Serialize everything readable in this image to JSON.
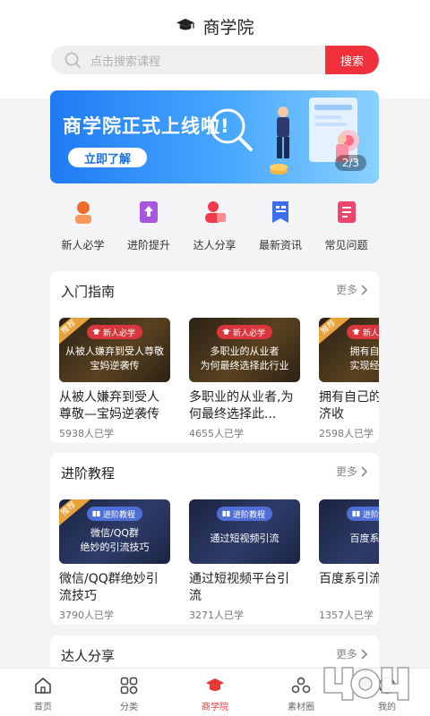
{
  "header": {
    "title": "商学院"
  },
  "search": {
    "placeholder": "点击搜索课程",
    "button": "搜索"
  },
  "banner": {
    "title": "商学院正式上线啦!",
    "cta": "立即了解",
    "page_current": 2,
    "page_total": 3,
    "page_label": "2/3"
  },
  "categories": [
    {
      "label": "新人必学",
      "icon": "badge-person-icon",
      "color": "#f06a2a"
    },
    {
      "label": "进阶提升",
      "icon": "book-up-icon",
      "color": "#a855e0"
    },
    {
      "label": "达人分享",
      "icon": "person-share-icon",
      "color": "#f03a4a"
    },
    {
      "label": "最新资讯",
      "icon": "news-flag-icon",
      "color": "#3b6ff0"
    },
    {
      "label": "常见问题",
      "icon": "notebook-icon",
      "color": "#f0456a"
    }
  ],
  "sections": [
    {
      "title": "入门指南",
      "more": "更多",
      "cards": [
        {
          "recommended": true,
          "badge_label": "推荐",
          "tag": "新人必学",
          "cover": [
            "从被人嫌弃到受人尊敬",
            "宝妈逆袭传"
          ],
          "title": "从被人嫌弃到受人尊敬—宝妈逆袭传",
          "learners": "5938人已学"
        },
        {
          "recommended": false,
          "tag": "新人必学",
          "cover": [
            "多职业的从业者",
            "为何最终选择此行业"
          ],
          "title": "多职业的从业者,为何最终选择此...",
          "learners": "4655人已学"
        },
        {
          "recommended": true,
          "badge_label": "推荐",
          "tag": "新人必学",
          "cover": [
            "拥有自己的",
            "实现经济收"
          ],
          "title": "拥有自己的实现经济收",
          "learners": "2598人已学"
        }
      ]
    },
    {
      "title": "进阶教程",
      "more": "更多",
      "cards": [
        {
          "recommended": true,
          "badge_label": "推荐",
          "tag": "进阶教程",
          "cover": [
            "微信/QQ群",
            "绝妙的引流技巧"
          ],
          "title": "微信/QQ群绝妙引流技巧",
          "learners": "3790人已学"
        },
        {
          "recommended": false,
          "tag": "进阶教程",
          "cover": [
            "通过短视频引流",
            ""
          ],
          "title": "通过短视频平台引流",
          "learners": "3271人已学"
        },
        {
          "recommended": false,
          "tag": "进阶教程",
          "cover": [
            "百度系引流",
            ""
          ],
          "title": "百度系引流享",
          "learners": "1357人已学"
        }
      ]
    },
    {
      "title": "达人分享",
      "more": "更多"
    }
  ],
  "tabbar": [
    {
      "label": "首页",
      "icon": "home-icon",
      "active": false
    },
    {
      "label": "分类",
      "icon": "grid-icon",
      "active": false
    },
    {
      "label": "商学院",
      "icon": "graduation-cap-icon",
      "active": true
    },
    {
      "label": "素材圈",
      "icon": "material-circle-icon",
      "active": false
    },
    {
      "label": "我的",
      "icon": "profile-icon",
      "active": false
    }
  ],
  "colors": {
    "accent": "#f0303a",
    "banner_blue": "#1f7bf2",
    "recommend_badge": "#e8a23a"
  }
}
